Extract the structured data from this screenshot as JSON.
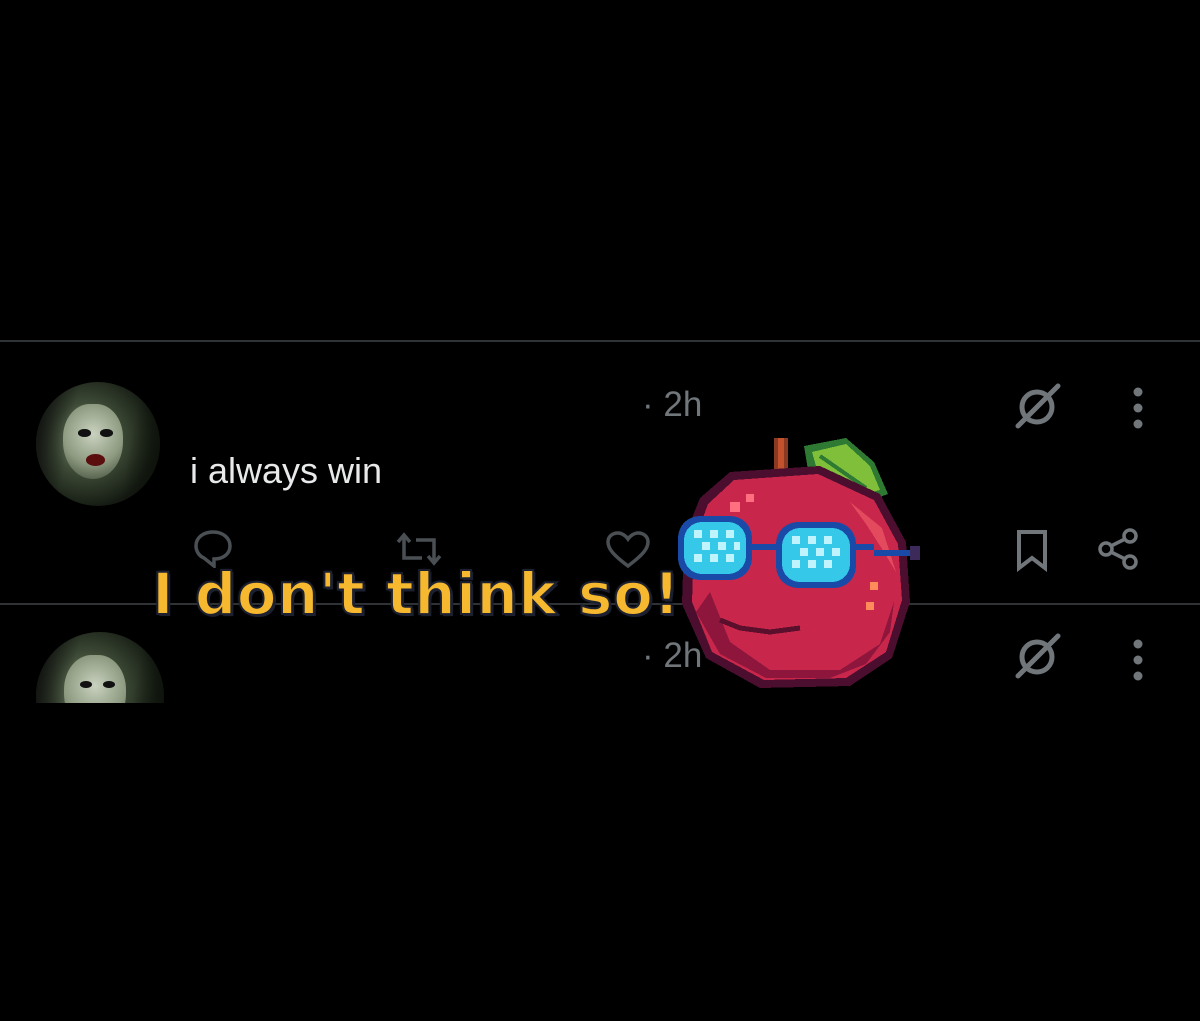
{
  "tweets": [
    {
      "avatar_alt": "profile avatar",
      "time": "· 2h",
      "text": "i always win"
    },
    {
      "avatar_alt": "profile avatar",
      "time": "· 2h",
      "text": ""
    }
  ],
  "icons": {
    "grok": "grok-icon",
    "more": "more-vertical-icon",
    "reply": "reply-icon",
    "retweet": "retweet-icon",
    "like": "like-icon",
    "bookmark": "bookmark-icon",
    "share": "share-icon"
  },
  "overlay": {
    "caption": "I don't think so!",
    "sticker": "pixel-apple-with-sunglasses"
  },
  "colors": {
    "background": "#000000",
    "text": "#e7e9ea",
    "muted": "#71767b",
    "caption": "#f5b82e"
  }
}
